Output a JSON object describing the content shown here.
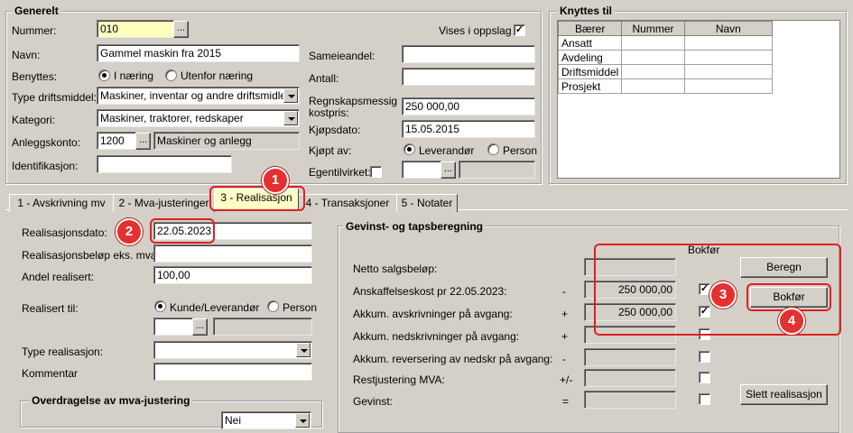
{
  "generelt": {
    "title": "Generelt",
    "nummer_label": "Nummer:",
    "nummer_value": "010",
    "navn_label": "Navn:",
    "navn_value": "Gammel maskin fra 2015",
    "benyttes_label": "Benyttes:",
    "benyttes_opt1": "I næring",
    "benyttes_opt2": "Utenfor næring",
    "type_label": "Type driftsmiddel:",
    "type_value": "Maskiner, inventar og andre driftsmidler",
    "kategori_label": "Kategori:",
    "kategori_value": "Maskiner, traktorer, redskaper",
    "anleggskonto_label": "Anleggskonto:",
    "anleggskonto_value": "1200",
    "anleggskonto_name": "Maskiner og anlegg",
    "identifikasjon_label": "Identifikasjon:",
    "vises_label": "Vises i oppslag",
    "sameieandel_label": "Sameieandel:",
    "antall_label": "Antall:",
    "kostpris_label_1": "Regnskapsmessig",
    "kostpris_label_2": "kostpris:",
    "kostpris_value": "250 000,00",
    "kjopsdato_label": "Kjøpsdato:",
    "kjopsdato_value": "15.05.2015",
    "kjopt_label": "Kjøpt av:",
    "kjopt_opt1": "Leverandør",
    "kjopt_opt2": "Person",
    "egentilvirket_label": "Egentilvirket:",
    "ellipsis": "..."
  },
  "knyttes": {
    "title": "Knyttes til",
    "headers": [
      "Bærer",
      "Nummer",
      "Navn"
    ],
    "rows": [
      "Ansatt",
      "Avdeling",
      "Driftsmiddel",
      "Prosjekt"
    ]
  },
  "tabs": [
    {
      "label": "1 - Avskrivning mv"
    },
    {
      "label": "2 - Mva-justeringer"
    },
    {
      "label": "3 - Realisasjon"
    },
    {
      "label": "4 - Transaksjoner"
    },
    {
      "label": "5 - Notater"
    }
  ],
  "realisasjon": {
    "dato_label": "Realisasjonsdato:",
    "dato_value": "22.05.2023",
    "belop_label": "Realisasjonsbeløp eks. mva.:",
    "andel_label": "Andel realisert:",
    "andel_value": "100,00",
    "realisert_til_label": "Realisert til:",
    "opt1": "Kunde/Leverandør",
    "opt2": "Person",
    "type_label": "Type realisasjon:",
    "kommentar_label": "Kommentar",
    "overdragelse_title": "Overdragelse av mva-justering",
    "overdragelse_value": "Nei"
  },
  "gevinst": {
    "title": "Gevinst- og tapsberegning",
    "bokfor_header": "Bokfør",
    "rows": [
      {
        "label": "Netto salgsbeløp:",
        "sign": "",
        "value": "",
        "checked": false
      },
      {
        "label": "Anskaffelseskost pr 22.05.2023:",
        "sign": "-",
        "value": "250 000,00",
        "checked": true
      },
      {
        "label": "Akkum. avskrivninger på avgang:",
        "sign": "+",
        "value": "250 000,00",
        "checked": true
      },
      {
        "label": "Akkum. nedskrivninger på avgang:",
        "sign": "+",
        "value": "",
        "checked": false
      },
      {
        "label": "Akkum. reversering  av nedskr på avgang:",
        "sign": "-",
        "value": "",
        "checked": false
      },
      {
        "label": "Restjustering MVA:",
        "sign": "+/-",
        "value": "",
        "checked": false
      },
      {
        "label": "Gevinst:",
        "sign": "=",
        "value": "",
        "checked": false
      }
    ],
    "beregn_label": "Beregn",
    "bokfor_label": "Bokfør",
    "slett_label": "Slett realisasjon"
  },
  "markers": [
    "1",
    "2",
    "3",
    "4"
  ],
  "accent_color": "#e02020",
  "active_tab_color": "#ffffc8"
}
